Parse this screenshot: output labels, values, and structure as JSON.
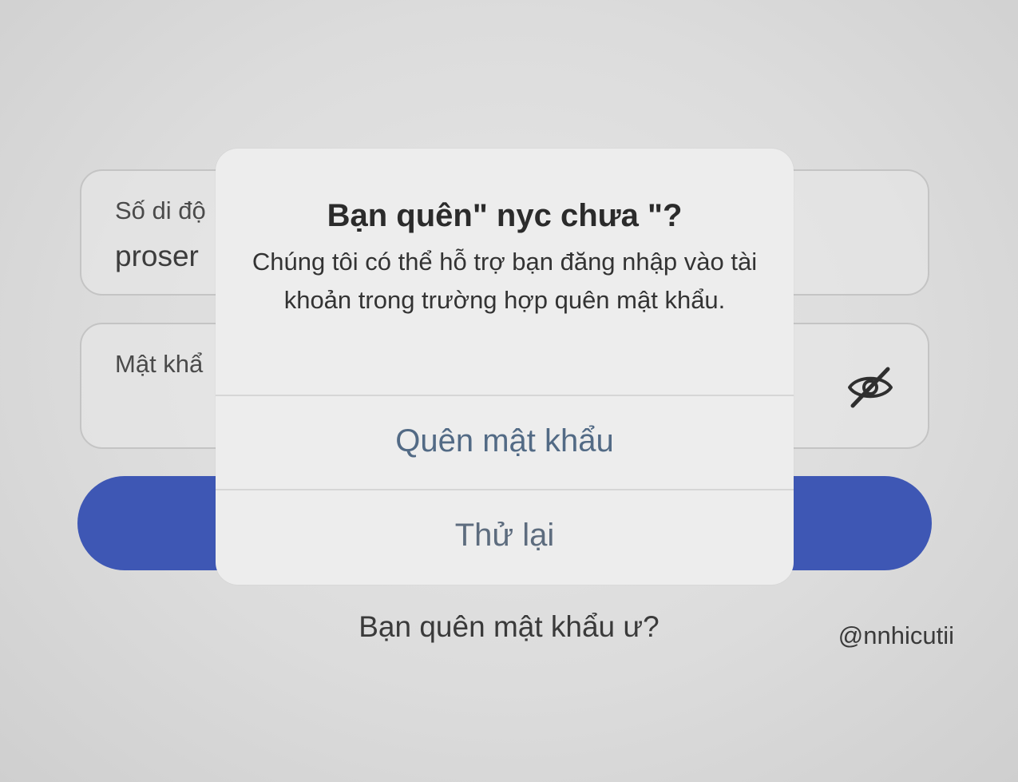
{
  "login_form": {
    "phone_field_label": "Số di độ",
    "phone_field_value": "proser",
    "password_field_label": "Mật khẩ",
    "forgot_password_link": "Bạn quên mật khẩu ư?"
  },
  "dialog": {
    "title": "Bạn quên\" nyc chưa \"?",
    "message": "Chúng tôi có thể hỗ trợ bạn đăng nhập vào tài khoản trong trường hợp quên mật khẩu.",
    "buttons": {
      "forgot_password": "Quên mật khẩu",
      "retry": "Thử lại"
    }
  },
  "watermark": "@nnhicutii",
  "colors": {
    "primary_button": "#3e57b4",
    "dialog_button_text": "#526a85"
  },
  "icons": {
    "password_toggle": "eye-slash-icon"
  }
}
